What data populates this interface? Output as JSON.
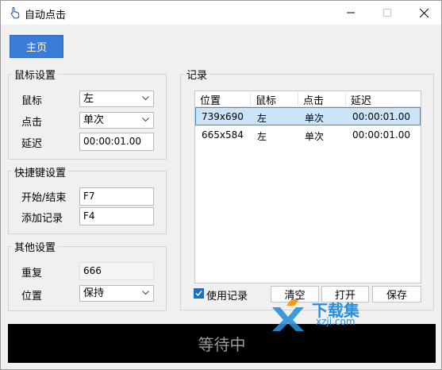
{
  "window": {
    "title": "自动点击"
  },
  "nav": {
    "home_label": "主页"
  },
  "mouse_settings": {
    "title": "鼠标设置",
    "mouse_label": "鼠标",
    "mouse_value": "左",
    "click_label": "点击",
    "click_value": "单次",
    "delay_label": "延迟",
    "delay_value": "00:00:01.00"
  },
  "hotkey_settings": {
    "title": "快捷键设置",
    "start_stop_label": "开始/结束",
    "start_stop_value": "F7",
    "add_record_label": "添加记录",
    "add_record_value": "F4"
  },
  "other_settings": {
    "title": "其他设置",
    "repeat_label": "重复",
    "repeat_value": "666",
    "position_label": "位置",
    "position_value": "保持"
  },
  "records": {
    "title": "记录",
    "columns": [
      "位置",
      "鼠标",
      "点击",
      "延迟"
    ],
    "rows": [
      {
        "position": "739x690",
        "mouse": "左",
        "click": "单次",
        "delay": "00:00:01.00"
      },
      {
        "position": "665x584",
        "mouse": "左",
        "click": "单次",
        "delay": "00:00:01.00"
      }
    ],
    "use_record_label": "使用记录",
    "use_record_checked": true,
    "clear_label": "清空",
    "open_label": "打开",
    "save_label": "保存"
  },
  "status": {
    "text": "等待中"
  },
  "watermark": {
    "text_cn": "下载集",
    "text_url": "xzji.com"
  },
  "colors": {
    "accent": "#3a7bd5",
    "selection": "#cce4f7",
    "status_bg": "#000000"
  }
}
